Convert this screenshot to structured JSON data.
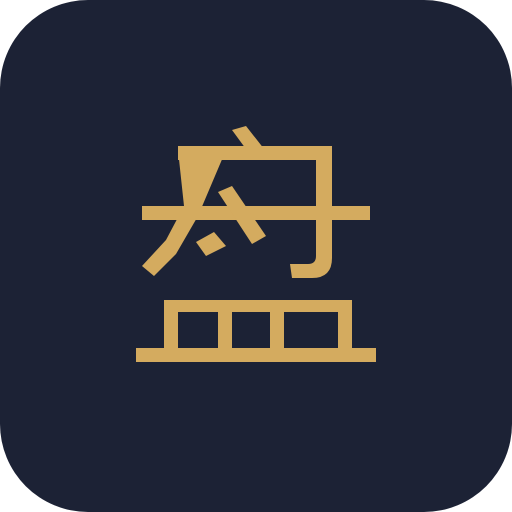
{
  "app_icon": {
    "glyph": "盘",
    "background_color": "#1c2235",
    "glyph_color": "#d4ab5f"
  }
}
